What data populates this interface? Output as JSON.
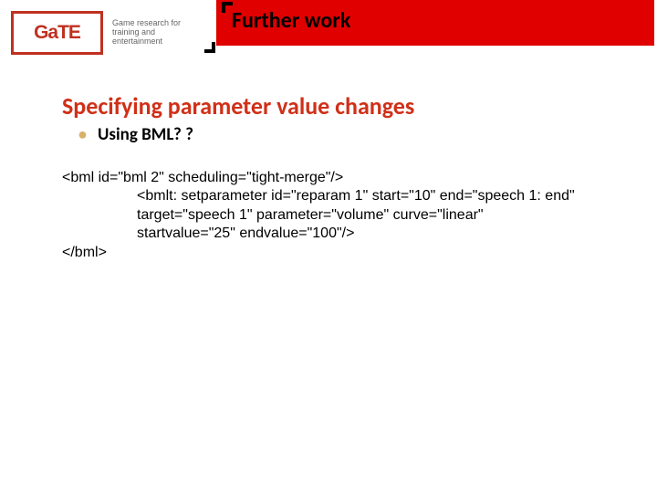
{
  "logo": {
    "text": "GaTE",
    "tagline": "Game research for training and entertainment"
  },
  "banner": {
    "title": "Further work"
  },
  "section": {
    "title": "Specifying parameter value changes"
  },
  "bullet": {
    "text": "Using BML? ?"
  },
  "code": {
    "l1": "<bml id=\"bml 2\" scheduling=\"tight-merge\"/>",
    "l2": "<bmlt: setparameter id=\"reparam 1\" start=\"10\" end=\"speech 1: end\"",
    "l3": "target=\"speech 1\" parameter=\"volume\" curve=\"linear\"",
    "l4": "startvalue=\"25\" endvalue=\"100\"/>",
    "l5": "</bml>"
  }
}
